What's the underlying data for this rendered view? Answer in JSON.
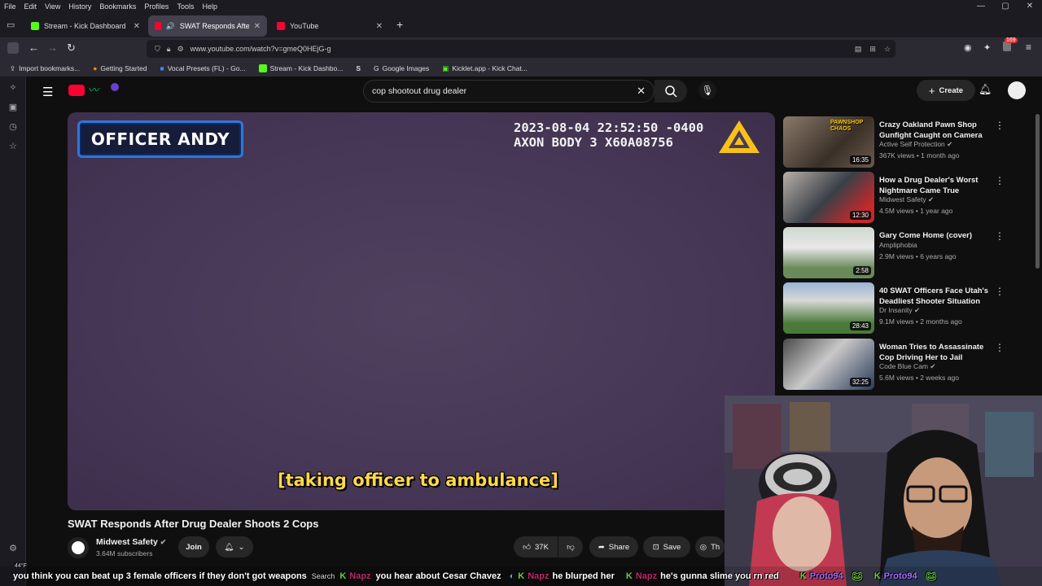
{
  "menu": [
    "File",
    "Edit",
    "View",
    "History",
    "Bookmarks",
    "Profiles",
    "Tools",
    "Help"
  ],
  "window_controls": [
    "—",
    "▢",
    "✕"
  ],
  "tabs": [
    {
      "label": "Stream - Kick Dashboard",
      "color": "#53fc18"
    },
    {
      "label": "SWAT Responds After Drug",
      "color": "#ff0033"
    },
    {
      "label": "YouTube",
      "color": "#ff0033"
    }
  ],
  "url": "www.youtube.com/watch?v=gmeQ0HEjG-g",
  "bookmarks": [
    "Import bookmarks...",
    "Getting Started",
    "Vocal Presets (FL) - Go...",
    "Stream - Kick Dashbo...",
    "",
    "Google Images",
    "Kicklet.app - Kick Chat..."
  ],
  "browser_badge": "169",
  "search": {
    "query": "cop shootout drug dealer",
    "clear": "✕"
  },
  "create_label": "Create",
  "video": {
    "officer_label": "OFFICER ANDY",
    "timestamp_line1": "2023-08-04 22:52:50 -0400",
    "timestamp_line2": "AXON BODY 3 X60A08756",
    "caption": "[taking officer to ambulance]",
    "title": "SWAT Responds After Drug Dealer Shoots 2 Cops"
  },
  "channel": {
    "name": "Midwest Safety",
    "subs": "3.64M subscribers",
    "join": "Join"
  },
  "actions": {
    "likes": "37K",
    "share": "Share",
    "save": "Save",
    "thanks": "Th"
  },
  "recommendations": [
    {
      "title": "Crazy Oakland Pawn Shop Gunfight Caught on Camera",
      "channel": "Active Self Protection",
      "meta": "367K views • 1 month ago",
      "duration": "16:35",
      "thumb_overlay": "PAWNSHOP CHAOS"
    },
    {
      "title": "How a Drug Dealer's Worst Nightmare Came True",
      "channel": "Midwest Safety",
      "meta": "4.5M views • 1 year ago",
      "duration": "12:30",
      "thumb_overlay": ""
    },
    {
      "title": "Gary Come Home (cover)",
      "channel": "Ampliphobia",
      "meta": "2.9M views • 6 years ago",
      "duration": "2:58",
      "thumb_overlay": ""
    },
    {
      "title": "40 SWAT Officers Face Utah's Deadliest Shooter Situation",
      "channel": "Dr Insanity",
      "meta": "9.1M views • 2 months ago",
      "duration": "28:43",
      "thumb_overlay": ""
    },
    {
      "title": "Woman Tries to Assassinate Cop Driving Her to Jail",
      "channel": "Code Blue Cam",
      "meta": "5.6M views • 2 weeks ago",
      "duration": "32:25",
      "thumb_overlay": ""
    }
  ],
  "chat": {
    "m1": "you think you can beat up 3 female officers if they don't got weapons",
    "u2": "Napz",
    "m2": "you hear about Cesar Chavez",
    "u3": "Napz",
    "m3": "he blurped her",
    "u4": "Napz",
    "m4": "he's gunna slime you rn red",
    "u5": "Proto94",
    "u6": "Proto94",
    "weather": "44°F",
    "taskbar_search": "Search"
  }
}
